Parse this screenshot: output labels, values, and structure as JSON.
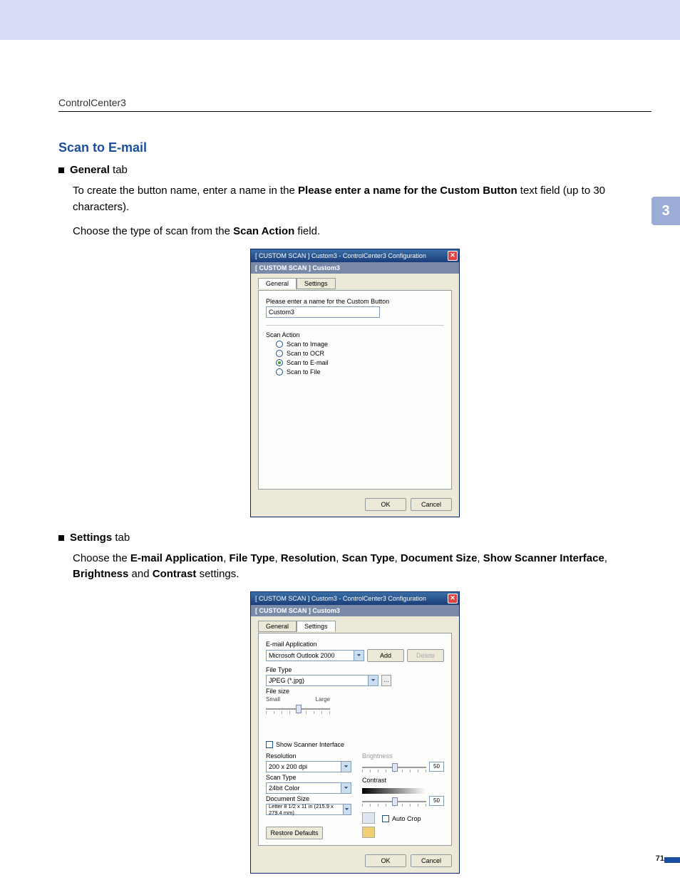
{
  "header": {
    "sub": "ControlCenter3",
    "side_tab": "3",
    "page_number": "71"
  },
  "section": {
    "title": "Scan to E-mail",
    "general_tab_label": "General",
    "tab_suffix": " tab",
    "general_intro_pre": "To create the button name, enter a name in the ",
    "general_intro_bold": "Please enter a name for the Custom Button",
    "general_intro_post": " text field (up to 30 characters).",
    "general_choose_pre": "Choose the type of scan from the ",
    "general_choose_bold": "Scan Action",
    "general_choose_post": " field.",
    "settings_tab_label": "Settings",
    "settings_intro_pre": "Choose the ",
    "settings_terms": [
      "E-mail Application",
      "File Type",
      "Resolution",
      "Scan Type",
      "Document Size",
      "Show Scanner Interface",
      "Brightness",
      "Contrast"
    ],
    "settings_and": " and ",
    "settings_sep": ", ",
    "settings_post": " settings."
  },
  "dialog1": {
    "title": "[  CUSTOM SCAN  ]   Custom3 - ControlCenter3 Configuration",
    "subtitle": "[  CUSTOM SCAN  ]   Custom3",
    "tab_general": "General",
    "tab_settings": "Settings",
    "field_label": "Please enter a name for the Custom Button",
    "field_value": "Custom3",
    "scan_action": "Scan Action",
    "radios": {
      "image": "Scan to Image",
      "ocr": "Scan to OCR",
      "email": "Scan to E-mail",
      "file": "Scan to File"
    },
    "ok": "OK",
    "cancel": "Cancel"
  },
  "dialog2": {
    "title": "[  CUSTOM SCAN  ]   Custom3 - ControlCenter3 Configuration",
    "subtitle": "[  CUSTOM SCAN  ]   Custom3",
    "tab_general": "General",
    "tab_settings": "Settings",
    "email_app_label": "E-mail Application",
    "email_app_value": "Microsoft Outlook 2000",
    "add": "Add",
    "delete": "Delete",
    "file_type_label": "File Type",
    "file_type_value": "JPEG (*.jpg)",
    "file_size_label": "File size",
    "small": "Small",
    "large": "Large",
    "show_scanner": "Show Scanner Interface",
    "resolution_label": "Resolution",
    "resolution_value": "200 x 200 dpi",
    "scan_type_label": "Scan Type",
    "scan_type_value": "24bit Color",
    "doc_size_label": "Document Size",
    "doc_size_value": "Letter 8 1/2 x 11 in (215.9 x 279.4 mm)",
    "brightness": "Brightness",
    "contrast": "Contrast",
    "value": "50",
    "auto_crop": "Auto Crop",
    "restore": "Restore Defaults",
    "ok": "OK",
    "cancel": "Cancel"
  }
}
